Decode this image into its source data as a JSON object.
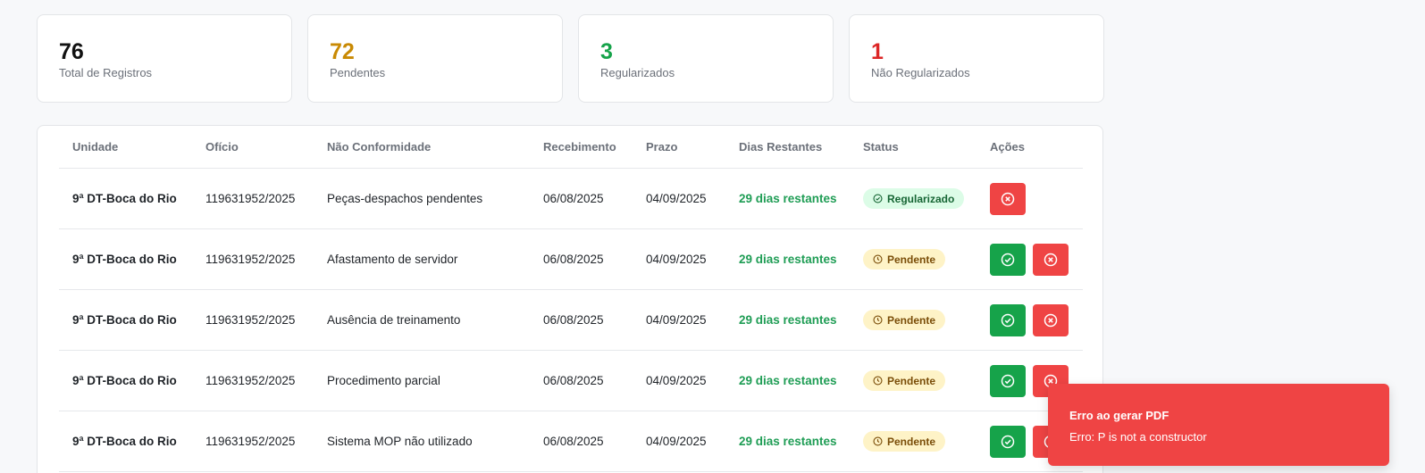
{
  "stats": [
    {
      "value": "76",
      "label": "Total de Registros",
      "color": "#111111"
    },
    {
      "value": "72",
      "label": "Pendentes",
      "color": "#c98a04"
    },
    {
      "value": "3",
      "label": "Regularizados",
      "color": "#16a34a"
    },
    {
      "value": "1",
      "label": "Não Regularizados",
      "color": "#dc2626"
    }
  ],
  "table": {
    "headers": [
      "Unidade",
      "Ofício",
      "Não Conformidade",
      "Recebimento",
      "Prazo",
      "Dias Restantes",
      "Status",
      "Ações"
    ],
    "rows": [
      {
        "unidade": "9ª DT-Boca do Rio",
        "oficio": "119631952/2025",
        "nao_conformidade": "Peças-despachos pendentes",
        "recebimento": "06/08/2025",
        "prazo": "04/09/2025",
        "dias": "29 dias restantes",
        "status": "Regularizado",
        "status_type": "ok",
        "actions": [
          "reject"
        ]
      },
      {
        "unidade": "9ª DT-Boca do Rio",
        "oficio": "119631952/2025",
        "nao_conformidade": "Afastamento de servidor",
        "recebimento": "06/08/2025",
        "prazo": "04/09/2025",
        "dias": "29 dias restantes",
        "status": "Pendente",
        "status_type": "pending",
        "actions": [
          "approve",
          "reject"
        ]
      },
      {
        "unidade": "9ª DT-Boca do Rio",
        "oficio": "119631952/2025",
        "nao_conformidade": "Ausência de treinamento",
        "recebimento": "06/08/2025",
        "prazo": "04/09/2025",
        "dias": "29 dias restantes",
        "status": "Pendente",
        "status_type": "pending",
        "actions": [
          "approve",
          "reject"
        ]
      },
      {
        "unidade": "9ª DT-Boca do Rio",
        "oficio": "119631952/2025",
        "nao_conformidade": "Procedimento parcial",
        "recebimento": "06/08/2025",
        "prazo": "04/09/2025",
        "dias": "29 dias restantes",
        "status": "Pendente",
        "status_type": "pending",
        "actions": [
          "approve",
          "reject"
        ]
      },
      {
        "unidade": "9ª DT-Boca do Rio",
        "oficio": "119631952/2025",
        "nao_conformidade": "Sistema MOP não utilizado",
        "recebimento": "06/08/2025",
        "prazo": "04/09/2025",
        "dias": "29 dias restantes",
        "status": "Pendente",
        "status_type": "pending",
        "actions": [
          "approve",
          "reject"
        ]
      }
    ]
  },
  "toast": {
    "title": "Erro ao gerar PDF",
    "message": "Erro: P is not a constructor"
  }
}
